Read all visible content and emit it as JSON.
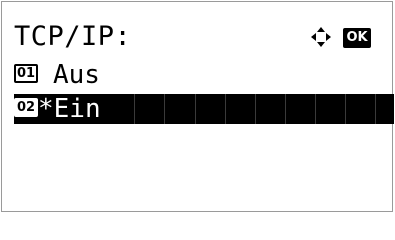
{
  "header": {
    "title": "TCP/IP:",
    "nav_icon": "four-way-arrow-icon",
    "ok_label": "OK"
  },
  "options": [
    {
      "number": "01",
      "label": "Aus",
      "selected": false
    },
    {
      "number": "02",
      "label": "*Ein",
      "selected": true
    }
  ],
  "colors": {
    "highlight": "#000000",
    "text": "#000000",
    "background": "#ffffff"
  }
}
